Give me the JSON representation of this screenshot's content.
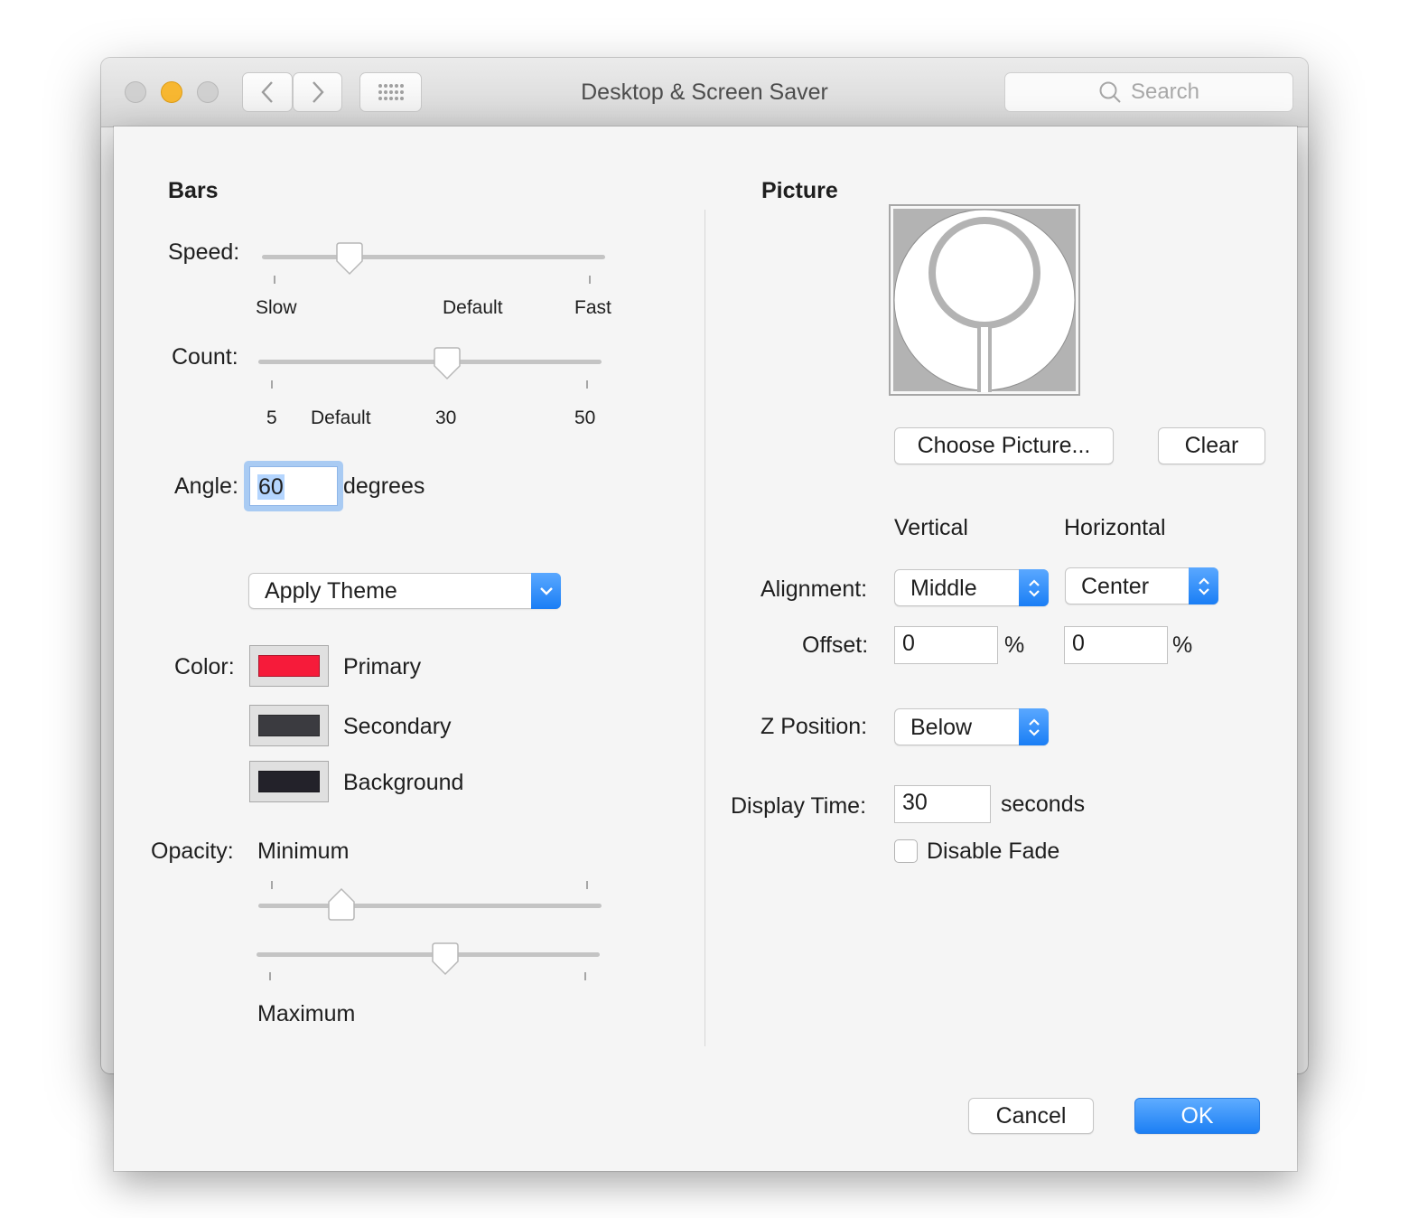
{
  "window": {
    "title": "Desktop & Screen Saver",
    "search_placeholder": "Search"
  },
  "bars": {
    "heading": "Bars",
    "speed": {
      "label": "Speed:",
      "value_fraction": 0.25,
      "tick_labels": [
        "Slow",
        "Default",
        "Fast"
      ]
    },
    "count": {
      "label": "Count:",
      "value": 30,
      "min": 5,
      "max": 50,
      "tick_labels": [
        "5",
        "Default",
        "30",
        "50"
      ]
    },
    "angle": {
      "label": "Angle:",
      "value": "60",
      "unit": "degrees"
    },
    "theme_popup": {
      "selected": "Apply Theme"
    },
    "color": {
      "label": "Color:",
      "items": [
        {
          "name": "Primary",
          "color": "#f61b3a"
        },
        {
          "name": "Secondary",
          "color": "#3b3b40"
        },
        {
          "name": "Background",
          "color": "#23222a"
        }
      ]
    },
    "opacity": {
      "label": "Opacity:",
      "minimum_label": "Minimum",
      "maximum_label": "Maximum",
      "minimum_fraction": 0.24,
      "maximum_fraction": 0.55
    }
  },
  "picture": {
    "heading": "Picture",
    "choose_button": "Choose Picture...",
    "clear_button": "Clear",
    "vertical_header": "Vertical",
    "horizontal_header": "Horizontal",
    "alignment": {
      "label": "Alignment:",
      "vertical": "Middle",
      "horizontal": "Center"
    },
    "offset": {
      "label": "Offset:",
      "vertical": "0",
      "horizontal": "0",
      "unit": "%"
    },
    "z_position": {
      "label": "Z Position:",
      "value": "Below"
    },
    "display_time": {
      "label": "Display Time:",
      "value": "30",
      "unit": "seconds"
    },
    "disable_fade": {
      "label": "Disable Fade",
      "checked": false
    }
  },
  "footer": {
    "cancel": "Cancel",
    "ok": "OK"
  },
  "colors": {
    "accent": "#1c7ff4",
    "close_light": "#d4d4d4",
    "minimize_light": "#f5b525",
    "zoom_light": "#d4d4d4"
  }
}
